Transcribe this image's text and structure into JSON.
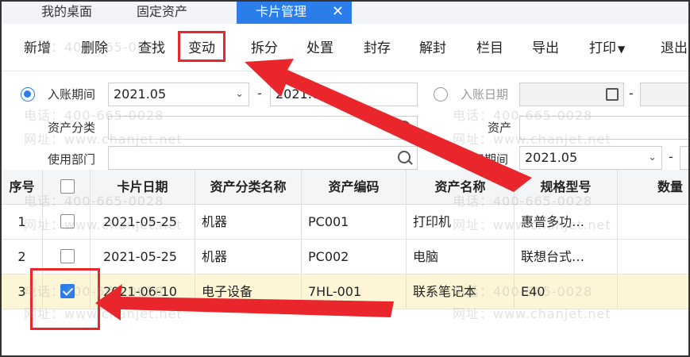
{
  "tabs": [
    {
      "label": "我的桌面"
    },
    {
      "label": "固定资产"
    },
    {
      "label": "卡片管理",
      "close": "✕"
    }
  ],
  "toolbar": {
    "add": "新增",
    "delete": "删除",
    "find": "查找",
    "change": "变动",
    "split": "拆分",
    "dispose": "处置",
    "seal": "封存",
    "unseal": "解封",
    "columns": "栏目",
    "export": "导出",
    "print": "打印",
    "exit": "退出"
  },
  "filters": {
    "period_label": "入账期间",
    "period_from": "2021.05",
    "period_to": "2021.06",
    "date_label": "入账日期",
    "category_label": "资产分类",
    "asset_label": "资产",
    "dept_label": "使用部门",
    "dep_period_label": "折旧期间",
    "dep_period_from": "2021.05"
  },
  "table": {
    "headers": [
      "序号",
      "",
      "卡片日期",
      "资产分类名称",
      "资产编码",
      "资产名称",
      "规格型号",
      "数量"
    ],
    "rows": [
      {
        "no": "1",
        "checked": false,
        "date": "2021-05-25",
        "category": "机器",
        "code": "PC001",
        "name": "打印机",
        "spec": "惠普多功…"
      },
      {
        "no": "2",
        "checked": false,
        "date": "2021-05-25",
        "category": "机器",
        "code": "PC002",
        "name": "电脑",
        "spec": "联想台式…"
      },
      {
        "no": "3",
        "checked": true,
        "date": "2021-06-10",
        "category": "电子设备",
        "code": "7HL-001",
        "name": "联系笔记本",
        "spec": "E40"
      }
    ]
  },
  "watermark": {
    "phone": "电话：400-665-0028",
    "site": "网址：www.chanjet.net"
  },
  "colors": {
    "accent": "#2b7de9",
    "annotation": "#e8262b",
    "selected_row": "#fdf6d6"
  }
}
